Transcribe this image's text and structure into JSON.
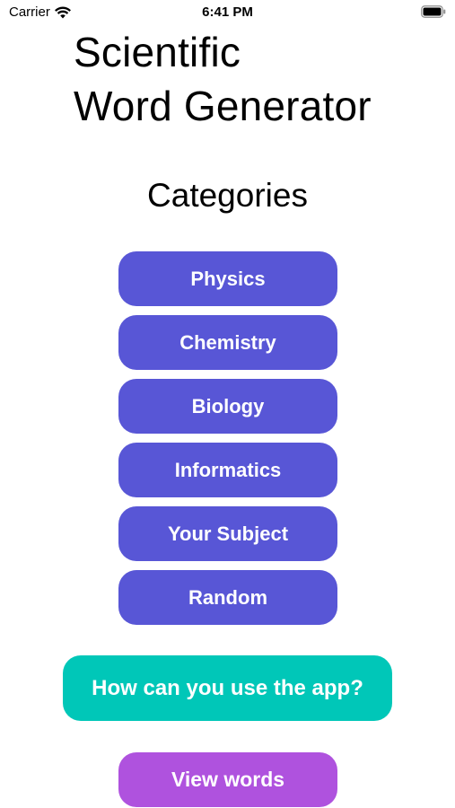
{
  "status_bar": {
    "carrier": "Carrier",
    "time": "6:41 PM",
    "wifi_icon": "wifi-icon",
    "battery_icon": "battery-full-icon"
  },
  "title": {
    "line1": "Scientific",
    "line2": "Word Generator"
  },
  "categories": {
    "heading": "Categories",
    "items": [
      {
        "label": "Physics"
      },
      {
        "label": "Chemistry"
      },
      {
        "label": "Biology"
      },
      {
        "label": "Informatics"
      },
      {
        "label": "Your Subject"
      },
      {
        "label": "Random"
      }
    ]
  },
  "help_button": {
    "label": "How can you use the app?"
  },
  "view_words_button": {
    "label": "View words"
  },
  "colors": {
    "category_button": "#5856d6",
    "help_button": "#00c7b8",
    "view_words_button": "#af52de",
    "button_text": "#ffffff"
  }
}
